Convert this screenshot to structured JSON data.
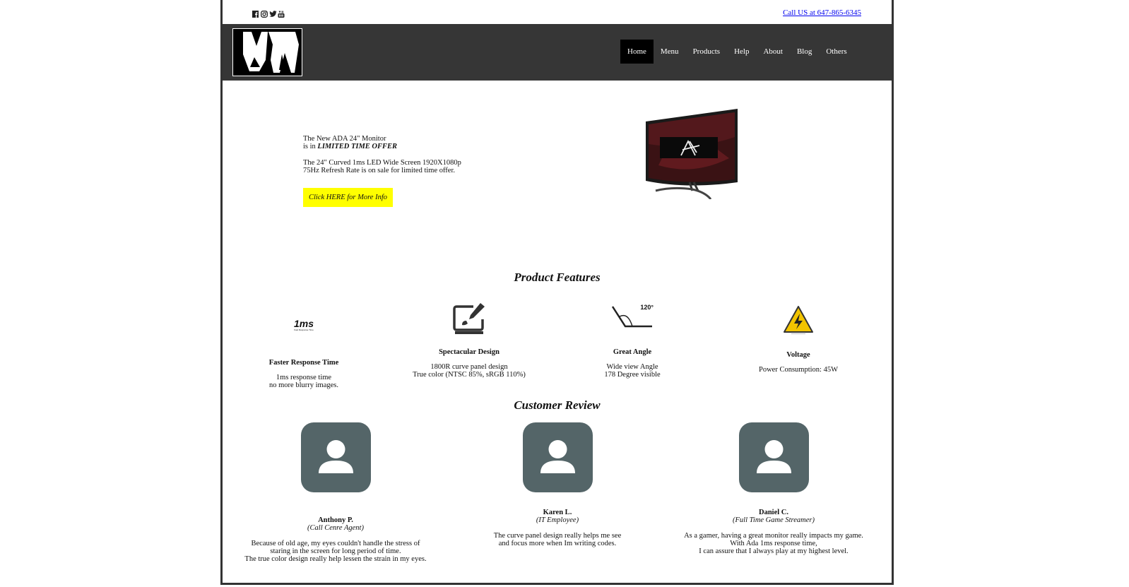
{
  "header": {
    "social_icons": [
      "facebook-icon",
      "instagram-icon",
      "twitter-icon",
      "youtube-icon"
    ],
    "call_link": "Call US at 647-865-6345"
  },
  "nav": {
    "items": [
      "Home",
      "Menu",
      "Products",
      "Help",
      "About",
      "Blog",
      "Others"
    ],
    "active": "Home"
  },
  "hero": {
    "line1": "The New ADA 24\" Monitor",
    "line2_prefix": "is in ",
    "line2_emph": "LIMITED TIME OFFER",
    "desc1": "The 24\" Curved 1ms LED Wide Screen 1920X1080p",
    "desc2": "75Hz Refresh Rate is on sale for limited time offer.",
    "cta": "Click HERE for More Info"
  },
  "features": {
    "heading": "Product Features",
    "items": [
      {
        "icon": "1ms-icon",
        "icon_text": "1ms",
        "icon_sub": "Fast Response Time",
        "title": "Faster Response Time",
        "line1": "1ms response time",
        "line2": "no more blurry images."
      },
      {
        "icon": "design-tablet-icon",
        "title": "Spectacular Design",
        "line1": "1800R curve panel design",
        "line2": "True color (NTSC 85%, sRGB 110%)"
      },
      {
        "icon": "angle-icon",
        "icon_text": "120°",
        "title": "Great Angle",
        "line1": "Wide view Angle",
        "line2": "178 Degree visible"
      },
      {
        "icon": "voltage-warning-icon",
        "title": "Voltage",
        "line1": "Power Consumption: 45W",
        "line2": ""
      }
    ]
  },
  "reviews": {
    "heading": "Customer Review",
    "items": [
      {
        "name": "Anthony P.",
        "role": "(Call Cenre Agent)",
        "line1": "Because of old age, my eyes couldn't handle the stress of",
        "line2": "staring in the screen for long period of time.",
        "line3": "The true color design really help lessen the strain in my eyes."
      },
      {
        "name": "Karen L.",
        "role": "(IT Employee)",
        "line1": "The curve panel design really helps me see",
        "line2": "and focus more when Im writing codes.",
        "line3": ""
      },
      {
        "name": "Daniel C.",
        "role": "(Full Time Game Streamer)",
        "line1": "As a gamer, having a great monitor really impacts my game.",
        "line2": "With Ada 1ms response time,",
        "line3": "I can assure that I always play at my highest level."
      }
    ]
  },
  "colors": {
    "navbar": "#363636",
    "active_nav": "#000000",
    "cta_bg": "#ffff00",
    "avatar_bg": "#546568",
    "link": "#0000ee"
  }
}
